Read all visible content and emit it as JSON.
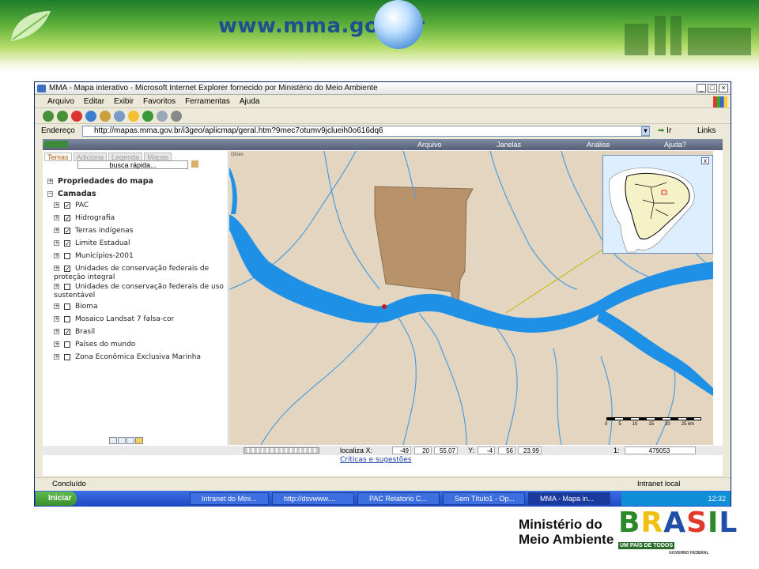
{
  "banner": {
    "site_url": "www.mma.gov.br"
  },
  "window": {
    "title": "MMA - Mapa interativo - Microsoft Internet Explorer fornecido por Ministério do Meio Ambiente",
    "controls": [
      "_",
      "□",
      "×"
    ]
  },
  "menu": [
    "Arquivo",
    "Editar",
    "Exibir",
    "Favoritos",
    "Ferramentas",
    "Ajuda"
  ],
  "address": {
    "label": "Endereço",
    "url": "http://mapas.mma.gov.br/i3geo/aplicmap/geral.htm?9mec7otumv9jclueih0o616dq6",
    "go_label": "Ir",
    "links_label": "Links"
  },
  "app_menu": [
    "Arquivo",
    "Janelas",
    "Análise",
    "Ajuda?"
  ],
  "tabs": [
    "Temas",
    "Adiciona",
    "Legenda",
    "Mapas"
  ],
  "search": {
    "label": "busca rápida..."
  },
  "tree": {
    "properties": "Propriedades do mapa",
    "layers_label": "Camadas",
    "layers": [
      {
        "label": "PAC",
        "checked": true
      },
      {
        "label": "Hidrografia",
        "checked": true
      },
      {
        "label": "Terras indígenas",
        "checked": true
      },
      {
        "label": "Limite Estadual",
        "checked": true
      },
      {
        "label": "Municípios-2001",
        "checked": false
      },
      {
        "label": "Unidades de conservação federais de proteção integral",
        "checked": true
      },
      {
        "label": "Unidades de conservação federais de uso sustentável",
        "checked": false
      },
      {
        "label": "Bioma",
        "checked": false
      },
      {
        "label": "Mosaico Landsat 7 falsa-cor",
        "checked": false
      },
      {
        "label": "Brasil",
        "checked": true
      },
      {
        "label": "Países do mundo",
        "checked": false
      },
      {
        "label": "Zona Econômica Exclusiva Marinha",
        "checked": false
      }
    ]
  },
  "map": {
    "credit": "i3Geo",
    "overview_close": "x",
    "scale_ticks": [
      "0",
      "5",
      "10",
      "15",
      "20",
      "25 km"
    ]
  },
  "locate": {
    "label": "localiza X:",
    "x": [
      "-49",
      "20",
      "55.07"
    ],
    "y_label": "Y:",
    "y": [
      "-4",
      "56",
      "23.99"
    ],
    "scale_prefix": "1:",
    "scale": "479053"
  },
  "criticas": "Críticas e sugestões",
  "status": {
    "left": "Concluído",
    "right": "Intranet local"
  },
  "taskbar": {
    "start": "Iniciar",
    "tasks": [
      "Intranet do Mini...",
      "http://dsvwww....",
      "PAC Relatorio C...",
      "Sem Título1 - Op...",
      "MMA - Mapa in..."
    ],
    "clock": "12:32"
  },
  "footer": {
    "ministry_line1": "Ministério do",
    "ministry_line2": "Meio Ambiente",
    "brasil_word": "BRASIL",
    "brasil_tagline": "UM PAÍS DE TODOS",
    "brasil_gov": "GOVERNO FEDERAL"
  },
  "colors": {
    "river": "#1e90e6",
    "land": "#e4d5c0",
    "indigenous": "#b8926a",
    "accent_orange": "#b25a00"
  }
}
